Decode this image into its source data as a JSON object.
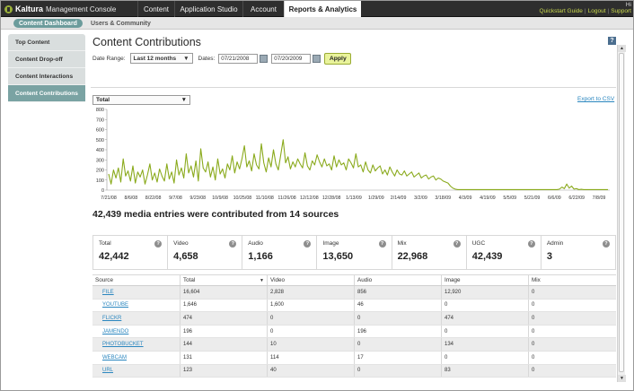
{
  "app": {
    "logo_text": "Kaltura",
    "console_text": "Management Console"
  },
  "nav": {
    "tabs": [
      {
        "label": "Content"
      },
      {
        "label": "Application Studio"
      },
      {
        "label": "Account"
      },
      {
        "label": "Reports & Analytics"
      }
    ],
    "greeting": "Hi",
    "links": [
      {
        "label": "Quickstart Guide"
      },
      {
        "label": "Logout"
      },
      {
        "label": "Support"
      }
    ],
    "link_separator": "|"
  },
  "subnav": {
    "tabs": [
      {
        "label": "Content Dashboard"
      },
      {
        "label": "Users & Community"
      }
    ]
  },
  "sidebar": {
    "items": [
      {
        "label": "Top Content"
      },
      {
        "label": "Content Drop-off"
      },
      {
        "label": "Content Interactions"
      },
      {
        "label": "Content Contributions"
      }
    ]
  },
  "page": {
    "title": "Content Contributions",
    "help_label": "?",
    "export_label": "Export to CSV",
    "summary": "42,439 media entries were contributed from 14 sources"
  },
  "filters": {
    "date_range_label": "Date Range:",
    "date_range_value": "Last 12 months",
    "dates_label": "Dates:",
    "date_from": "07/21/2008",
    "date_to": "07/20/2009",
    "apply_label": "Apply",
    "metric_value": "Total"
  },
  "chart_data": {
    "type": "line",
    "color": "#8aaa1c",
    "ylim": [
      0,
      800
    ],
    "yticks": [
      "0",
      "100",
      "200",
      "300",
      "400",
      "500",
      "600",
      "700",
      "800"
    ],
    "xtick_labels": [
      "7/21/08",
      "8/6/08",
      "8/22/08",
      "9/7/08",
      "9/23/08",
      "10/9/08",
      "10/25/08",
      "11/10/08",
      "11/26/08",
      "12/12/08",
      "12/28/08",
      "1/13/09",
      "1/29/09",
      "2/14/09",
      "3/2/09",
      "3/18/09",
      "4/3/09",
      "4/19/09",
      "5/5/09",
      "5/21/09",
      "6/6/09",
      "6/22/09",
      "7/8/09"
    ],
    "values": [
      160,
      60,
      200,
      120,
      220,
      80,
      310,
      140,
      190,
      90,
      240,
      70,
      180,
      130,
      200,
      60,
      150,
      260,
      100,
      170,
      80,
      210,
      140,
      90,
      260,
      110,
      180,
      70,
      300,
      150,
      220,
      120,
      360,
      170,
      240,
      130,
      290,
      90,
      410,
      220,
      180,
      280,
      130,
      230,
      100,
      310,
      160,
      210,
      120,
      260,
      200,
      340,
      170,
      280,
      210,
      310,
      440,
      230,
      290,
      190,
      360,
      250,
      210,
      460,
      270,
      180,
      320,
      230,
      400,
      260,
      200,
      350,
      500,
      270,
      330,
      210,
      280,
      230,
      310,
      260,
      220,
      370,
      240,
      200,
      290,
      250,
      350,
      280,
      230,
      310,
      240,
      260,
      200,
      340,
      230,
      300,
      250,
      270,
      200,
      310,
      270,
      220,
      360,
      230,
      250,
      180,
      280,
      200,
      170,
      250,
      190,
      220,
      240,
      160,
      200,
      150,
      230,
      180,
      140,
      200,
      160,
      150,
      190,
      140,
      160,
      180,
      130,
      150,
      170,
      120,
      140,
      150,
      110,
      130,
      140,
      100,
      120,
      110,
      90,
      80,
      70,
      40,
      20,
      10,
      5,
      5,
      5,
      5,
      5,
      5,
      5,
      5,
      5,
      5,
      5,
      5,
      5,
      5,
      5,
      5,
      5,
      5,
      5,
      5,
      5,
      5,
      5,
      5,
      5,
      5,
      5,
      5,
      5,
      5,
      5,
      5,
      5,
      5,
      5,
      5,
      5,
      5,
      5,
      5,
      5,
      5,
      10,
      30,
      15,
      60,
      20,
      40,
      10,
      15,
      5,
      8,
      5,
      5,
      5,
      5,
      5,
      5,
      5,
      5,
      5,
      5,
      5
    ]
  },
  "stats": [
    {
      "label": "Total",
      "value": "42,442"
    },
    {
      "label": "Video",
      "value": "4,658"
    },
    {
      "label": "Audio",
      "value": "1,166"
    },
    {
      "label": "Image",
      "value": "13,650"
    },
    {
      "label": "Mix",
      "value": "22,968"
    },
    {
      "label": "UGC",
      "value": "42,439"
    },
    {
      "label": "Admin",
      "value": "3"
    }
  ],
  "stat_info_label": "?",
  "table": {
    "headers": [
      "Source",
      "Total",
      "Video",
      "Audio",
      "Image",
      "Mix"
    ],
    "sort_indicator": "▼",
    "rows": [
      [
        "FILE",
        "16,604",
        "2,828",
        "856",
        "12,920",
        "0"
      ],
      [
        "YOUTUBE",
        "1,646",
        "1,600",
        "46",
        "0",
        "0"
      ],
      [
        "FLICKR",
        "474",
        "0",
        "0",
        "474",
        "0"
      ],
      [
        "JAMENDO",
        "196",
        "0",
        "196",
        "0",
        "0"
      ],
      [
        "PHOTOBUCKET",
        "144",
        "10",
        "0",
        "134",
        "0"
      ],
      [
        "WEBCAM",
        "131",
        "114",
        "17",
        "0",
        "0"
      ],
      [
        "URL",
        "123",
        "40",
        "0",
        "83",
        "0"
      ]
    ]
  },
  "scroll": {
    "up_arrow": "▲",
    "down_arrow": "▼"
  }
}
